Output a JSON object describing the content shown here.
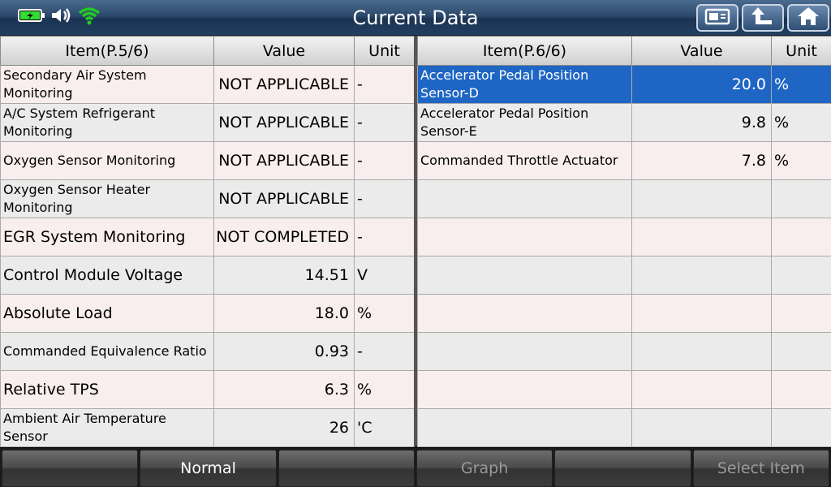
{
  "header": {
    "title": "Current Data",
    "icons": [
      "battery-charging-icon",
      "speaker-icon",
      "wifi-icon"
    ],
    "buttons": [
      "screenshot-icon",
      "back-arrow-icon",
      "home-icon"
    ]
  },
  "left_table": {
    "headers": {
      "item": "Item(P.5/6)",
      "value": "Value",
      "unit": "Unit"
    },
    "rows": [
      {
        "item": "Secondary Air System Monitoring",
        "value": "NOT APPLICABLE",
        "unit": "-"
      },
      {
        "item": "A/C System Refrigerant Monitoring",
        "value": "NOT APPLICABLE",
        "unit": "-"
      },
      {
        "item": "Oxygen Sensor Monitoring",
        "value": "NOT APPLICABLE",
        "unit": "-"
      },
      {
        "item": "Oxygen Sensor Heater Monitoring",
        "value": "NOT APPLICABLE",
        "unit": "-"
      },
      {
        "item": "EGR System Monitoring",
        "value": "NOT COMPLETED",
        "unit": "-"
      },
      {
        "item": "Control Module Voltage",
        "value": "14.51",
        "unit": "V"
      },
      {
        "item": "Absolute Load",
        "value": "18.0",
        "unit": "%"
      },
      {
        "item": "Commanded Equivalence Ratio",
        "value": "0.93",
        "unit": "-"
      },
      {
        "item": "Relative TPS",
        "value": "6.3",
        "unit": "%"
      },
      {
        "item": "Ambient Air Temperature Sensor",
        "value": "26",
        "unit": "'C"
      }
    ]
  },
  "right_table": {
    "headers": {
      "item": "Item(P.6/6)",
      "value": "Value",
      "unit": "Unit"
    },
    "rows": [
      {
        "item": "Accelerator Pedal Position Sensor-D",
        "value": "20.0",
        "unit": "%"
      },
      {
        "item": "Accelerator Pedal Position Sensor-E",
        "value": "9.8",
        "unit": "%"
      },
      {
        "item": "Commanded Throttle Actuator",
        "value": "7.8",
        "unit": "%"
      }
    ]
  },
  "bottom_bar": {
    "b1": "",
    "normal": "Normal",
    "b3": "",
    "graph": "Graph",
    "b5": "",
    "select_item": "Select Item"
  },
  "colors": {
    "selected_row": "#1f66c4",
    "wifi": "#22cc22",
    "battery": "#33dd33"
  }
}
